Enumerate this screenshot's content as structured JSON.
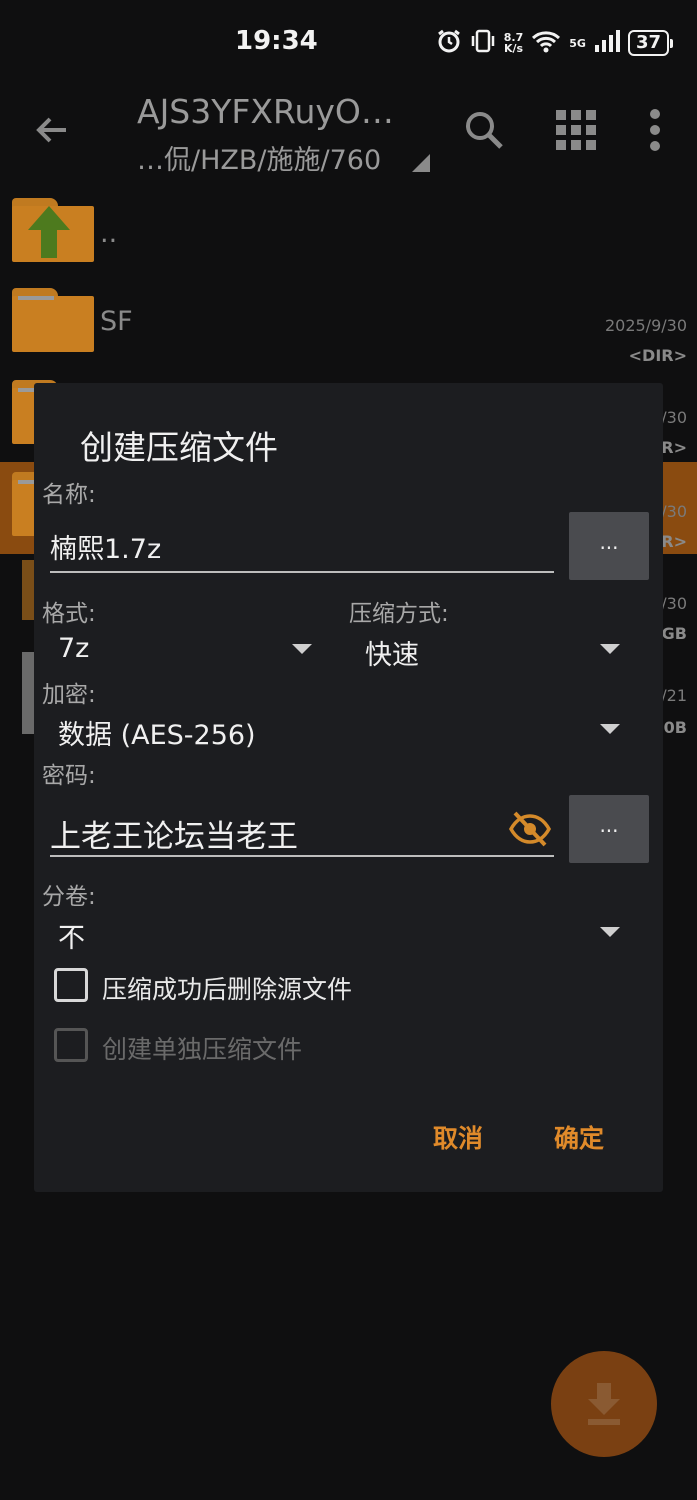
{
  "status_bar": {
    "time": "19:34",
    "speed_top": "8.7",
    "speed_unit": "K/s",
    "network": "5G",
    "battery": "37",
    "icons": [
      "alarm-icon",
      "vibrate-icon",
      "wifi-icon",
      "signal-icon",
      "battery-icon"
    ]
  },
  "toolbar": {
    "title": "AJS3YFXRuyO…",
    "path": "…侃/HZB/施施/760",
    "icons": [
      "back-arrow-icon",
      "search-icon",
      "grid-view-icon",
      "more-vert-icon"
    ]
  },
  "files": [
    {
      "name": "..",
      "date": "",
      "type": "",
      "icon": "folder-up-icon"
    },
    {
      "name": "SF",
      "date": "2025/9/30",
      "type": "<DIR>",
      "icon": "folder-icon"
    },
    {
      "name": "",
      "date": "/30",
      "type": "R>",
      "icon": "folder-icon"
    },
    {
      "name": "",
      "date": "/30",
      "type": "R>",
      "icon": "folder-icon"
    },
    {
      "name": "",
      "date": "/30",
      "type": "GB",
      "icon": "file-icon"
    },
    {
      "name": "",
      "date": "/21",
      "type": "0B",
      "icon": "file-icon"
    }
  ],
  "dialog": {
    "title": "创建压缩文件",
    "name_label": "名称:",
    "name_value": "楠熙1.7z",
    "browse_label": "...",
    "format_label": "格式:",
    "format_value": "7z",
    "method_label": "压缩方式:",
    "method_value": "快速",
    "encryption_label": "加密:",
    "encryption_value": "数据 (AES-256)",
    "password_label": "密码:",
    "password_value": "上老王论坛当老王",
    "password_btn_label": "...",
    "split_label": "分卷:",
    "split_value": "不",
    "delete_source_label": "压缩成功后删除源文件",
    "separate_archive_label": "创建单独压缩文件",
    "cancel_label": "取消",
    "ok_label": "确定"
  },
  "colors": {
    "accent": "#e08a2a",
    "dialog_bg": "#1c1d20",
    "folder": "#c97f21"
  }
}
